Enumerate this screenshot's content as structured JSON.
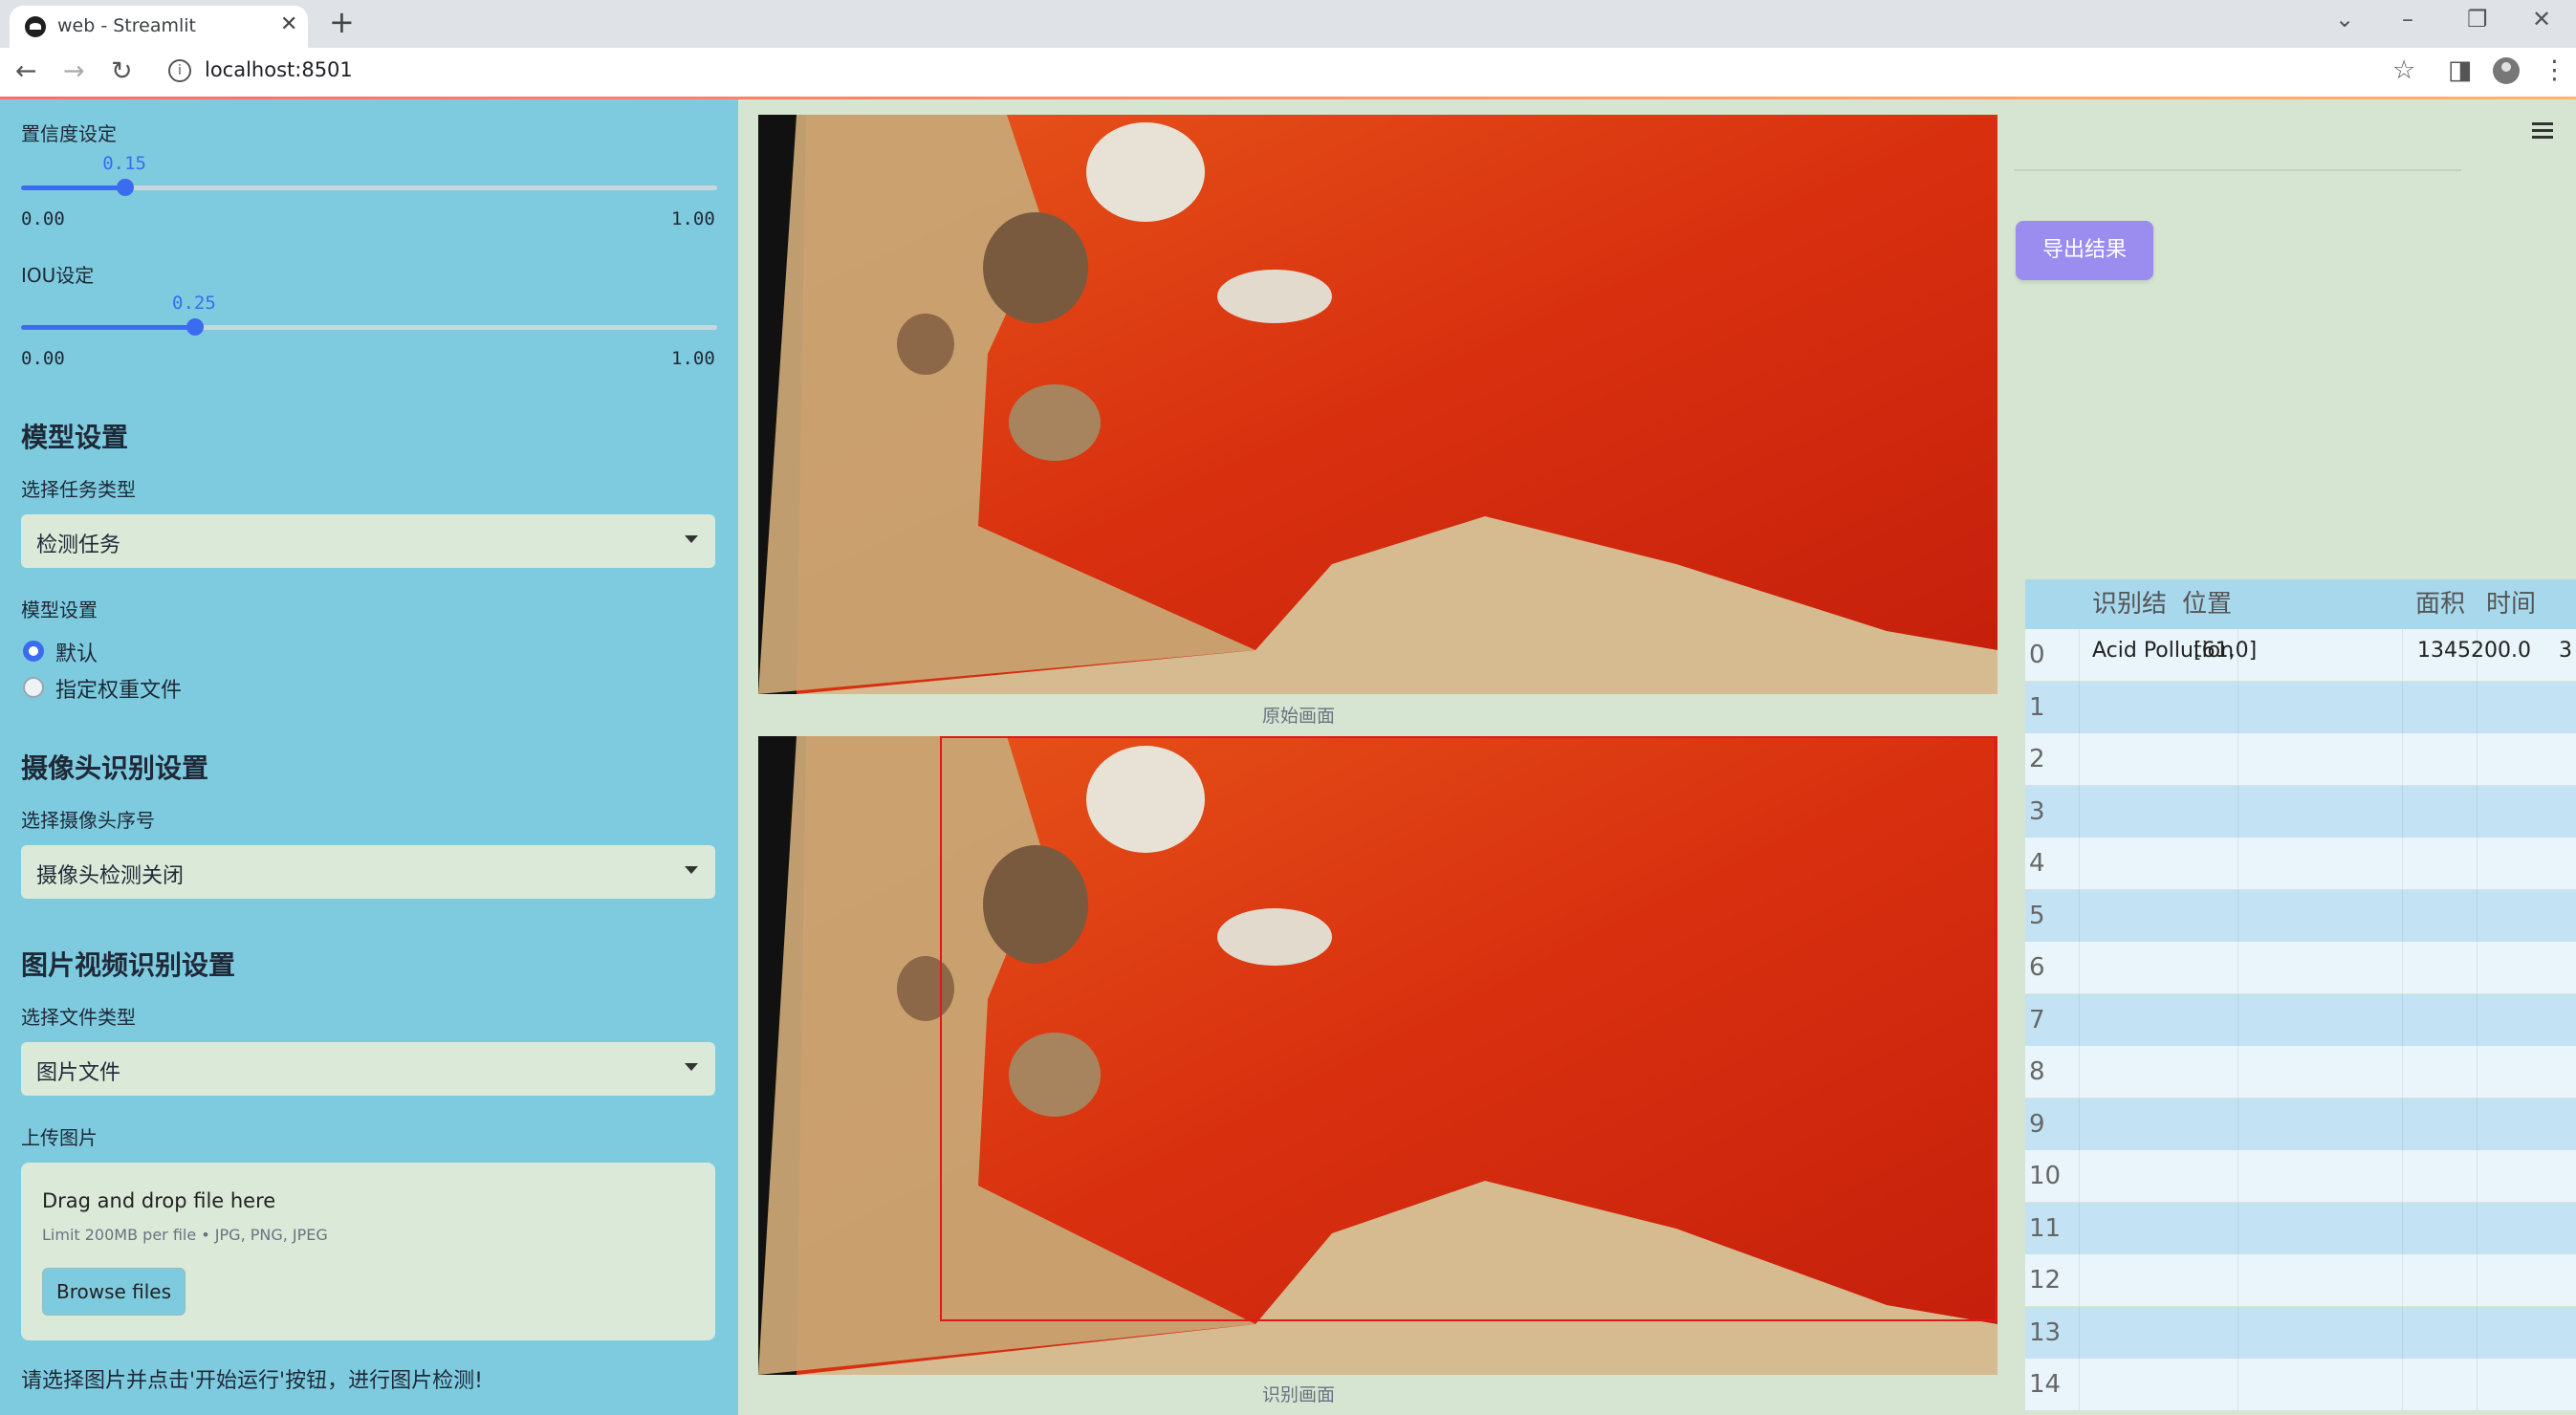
{
  "browser": {
    "tab_title": "web - Streamlit",
    "url": "localhost:8501"
  },
  "sidebar": {
    "confidence": {
      "label": "置信度设定",
      "value": "0.15",
      "fraction": 0.15,
      "min": "0.00",
      "max": "1.00"
    },
    "iou": {
      "label": "IOU设定",
      "value": "0.25",
      "fraction": 0.25,
      "min": "0.00",
      "max": "1.00"
    },
    "model_section": "模型设置",
    "task_label": "选择任务类型",
    "task_value": "检测任务",
    "model_label": "模型设置",
    "model_options": [
      "默认",
      "指定权重文件"
    ],
    "model_selected": "默认",
    "camera_section": "摄像头识别设置",
    "camera_label": "选择摄像头序号",
    "camera_value": "摄像头检测关闭",
    "media_section": "图片视频识别设置",
    "filetype_label": "选择文件类型",
    "filetype_value": "图片文件",
    "upload_label": "上传图片",
    "upload_main": "Drag and drop file here",
    "upload_sub": "Limit 200MB per file • JPG, PNG, JPEG",
    "browse_label": "Browse files",
    "footer_note": "请选择图片并点击'开始运行'按钮，进行图片检测!"
  },
  "main": {
    "original_caption": "原始画面",
    "result_caption": "识别画面"
  },
  "results": {
    "export_label": "导出结果",
    "columns": [
      "识别结果",
      "位置",
      "面积",
      "时间"
    ],
    "rows": [
      {
        "index": "0",
        "result": "Acid Pollution",
        "position": "[61,0]",
        "area": "1345200.0",
        "time": "3"
      },
      {
        "index": "1"
      },
      {
        "index": "2"
      },
      {
        "index": "3"
      },
      {
        "index": "4"
      },
      {
        "index": "5"
      },
      {
        "index": "6"
      },
      {
        "index": "7"
      },
      {
        "index": "8"
      },
      {
        "index": "9"
      },
      {
        "index": "10"
      },
      {
        "index": "11"
      },
      {
        "index": "12"
      },
      {
        "index": "13"
      },
      {
        "index": "14"
      }
    ]
  },
  "colors": {
    "sidebar": "#7ecbe0",
    "accent": "#3b6cf0",
    "export_button": "#9b8cf0",
    "detection_box": "#e01818"
  }
}
